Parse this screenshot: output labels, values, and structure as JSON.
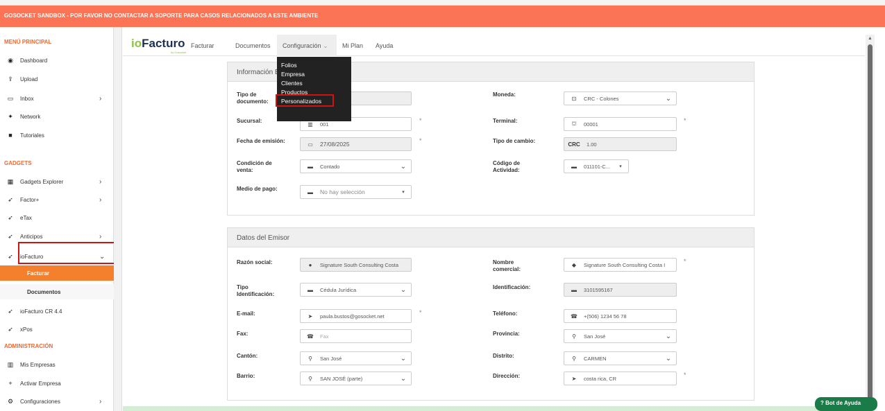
{
  "banner": "GOSOCKET SANDBOX - POR FAVOR NO CONTACTAR A SOPORTE PARA CASOS RELACIONADOS A ESTE AMBIENTE",
  "sidebar": {
    "menu_title": "MENÚ PRINCIPAL",
    "menu_items": [
      {
        "label": "Dashboard",
        "icon": "dashboard-icon"
      },
      {
        "label": "Upload",
        "icon": "upload-icon"
      },
      {
        "label": "Inbox",
        "icon": "inbox-icon"
      },
      {
        "label": "Network",
        "icon": "network-icon"
      },
      {
        "label": "Tutoriales",
        "icon": "video-icon"
      }
    ],
    "gadgets_title": "GADGETS",
    "gadget_items": [
      {
        "label": "Gadgets Explorer",
        "icon": "grid-icon"
      },
      {
        "label": "Factor+",
        "icon": "rocket-icon"
      },
      {
        "label": "eTax",
        "icon": "rocket-icon"
      },
      {
        "label": "Anticipos",
        "icon": "rocket-icon"
      },
      {
        "label": "ioFacturo",
        "icon": "rocket-icon"
      }
    ],
    "sub_items": [
      "Facturar",
      "Documentos"
    ],
    "more_items": [
      {
        "label": "ioFacturo CR 4.4",
        "icon": "rocket-icon"
      },
      {
        "label": "xPos",
        "icon": "rocket-icon"
      }
    ],
    "admin_title": "ADMINISTRACIÓN",
    "admin_items": [
      {
        "label": "Mis Empresas",
        "icon": "building-icon"
      },
      {
        "label": "Activar Empresa",
        "icon": "plus-icon"
      },
      {
        "label": "Configuraciones",
        "icon": "gears-icon"
      }
    ]
  },
  "navbar": {
    "logo_prefix": "io",
    "logo_word": "Facturo",
    "logo_sub": "by Gosocket",
    "items": [
      "Facturar",
      "Documentos",
      "Configuración",
      "Mi Plan",
      "Ayuda"
    ],
    "dropdown": [
      "Folios",
      "Empresa",
      "Clientes",
      "Productos",
      "Personalizados"
    ]
  },
  "info_panel": {
    "title": "Información B",
    "tipo_documento_label": "Tipo de documento:",
    "tipo_documento_value": "ctrónica",
    "moneda_label": "Moneda:",
    "moneda_value": "CRC - Colones",
    "sucursal_label": "Sucursal:",
    "sucursal_value": "001",
    "terminal_label": "Terminal:",
    "terminal_value": "00001",
    "fecha_label": "Fecha de emisión:",
    "fecha_value": "27/08/2025",
    "tipo_cambio_label": "Tipo de cambio:",
    "tipo_cambio_prefix": "CRC",
    "tipo_cambio_value": "1.00",
    "condicion_label": "Condición de venta:",
    "condicion_value": "Contado",
    "actividad_label": "Código de Actividad:",
    "actividad_value": "011101-C...",
    "medio_label": "Medio de pago:",
    "medio_value": "No hay selección"
  },
  "emisor_panel": {
    "title": "Datos del Emisor",
    "razon_label": "Razón social:",
    "razon_value": "Signature South Consulting Costa",
    "nombre_label": "Nombre comercial:",
    "nombre_value": "Signature South Consulting Costa I",
    "tipo_id_label": "Tipo Identificación:",
    "tipo_id_value": "Cédula Jurídica",
    "identificacion_label": "Identificación:",
    "identificacion_value": "3101595167",
    "email_label": "E-mail:",
    "email_value": "paula.bustos@gosocket.net",
    "telefono_label": "Teléfono:",
    "telefono_value": "+(506) 1234 56 78",
    "fax_label": "Fax:",
    "fax_placeholder": "Fax",
    "provincia_label": "Provincia:",
    "provincia_value": "San José",
    "canton_label": "Cantón:",
    "canton_value": "San José",
    "distrito_label": "Distrito:",
    "distrito_value": "CARMEN",
    "barrio_label": "Barrio:",
    "barrio_value": "SAN JOSÉ (parte)",
    "direccion_label": "Dirección:",
    "direccion_value": "costa rica, CR"
  },
  "required_mark": "*",
  "help_button": "Bot de Ayuda",
  "colors": {
    "accent": "#f47f2c",
    "banner": "#fb7456",
    "highlight": "#d11212"
  }
}
